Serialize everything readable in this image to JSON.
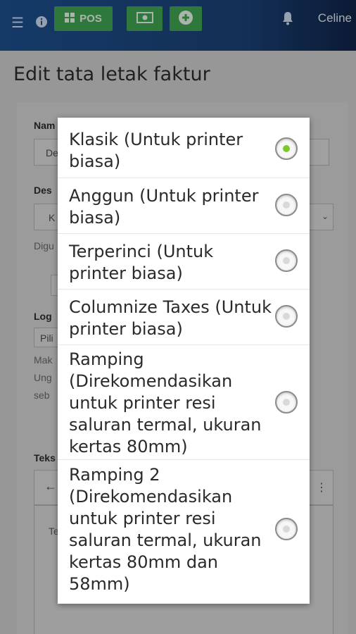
{
  "topbar": {
    "pos_label": "POS",
    "user_name": "Celine"
  },
  "page": {
    "title": "Edit tata letak faktur",
    "bg_label_name": "Nam",
    "bg_input_name": "De",
    "bg_label_desc": "Des",
    "bg_input_desc": "K",
    "bg_hint": "Digu",
    "bg_label_logo": "Log",
    "bg_input_logo": "Pili",
    "bg_text_1": "Mak",
    "bg_text_2": "Ung",
    "bg_text_3": "seb",
    "bg_label_text": "Teks",
    "bg_editor_text": "Te"
  },
  "dialog": {
    "selected": "Klasik (Untuk printer biasa)",
    "options": [
      {
        "label": "Klasik (Untuk printer biasa)"
      },
      {
        "label": "Anggun (Untuk printer biasa)"
      },
      {
        "label": "Terperinci (Untuk printer biasa)"
      },
      {
        "label": "Columnize Taxes (Untuk printer biasa)"
      },
      {
        "label": "Ramping (Direkomendasikan untuk printer resi saluran termal, ukuran kertas 80mm)"
      },
      {
        "label": "Ramping 2 (Direkomendasikan untuk printer resi saluran termal, ukuran kertas 80mm dan 58mm)"
      }
    ]
  },
  "colors": {
    "topbar": "#1c4e8a",
    "button_green": "#3fa04f",
    "radio_selected": "#7dc82b"
  }
}
